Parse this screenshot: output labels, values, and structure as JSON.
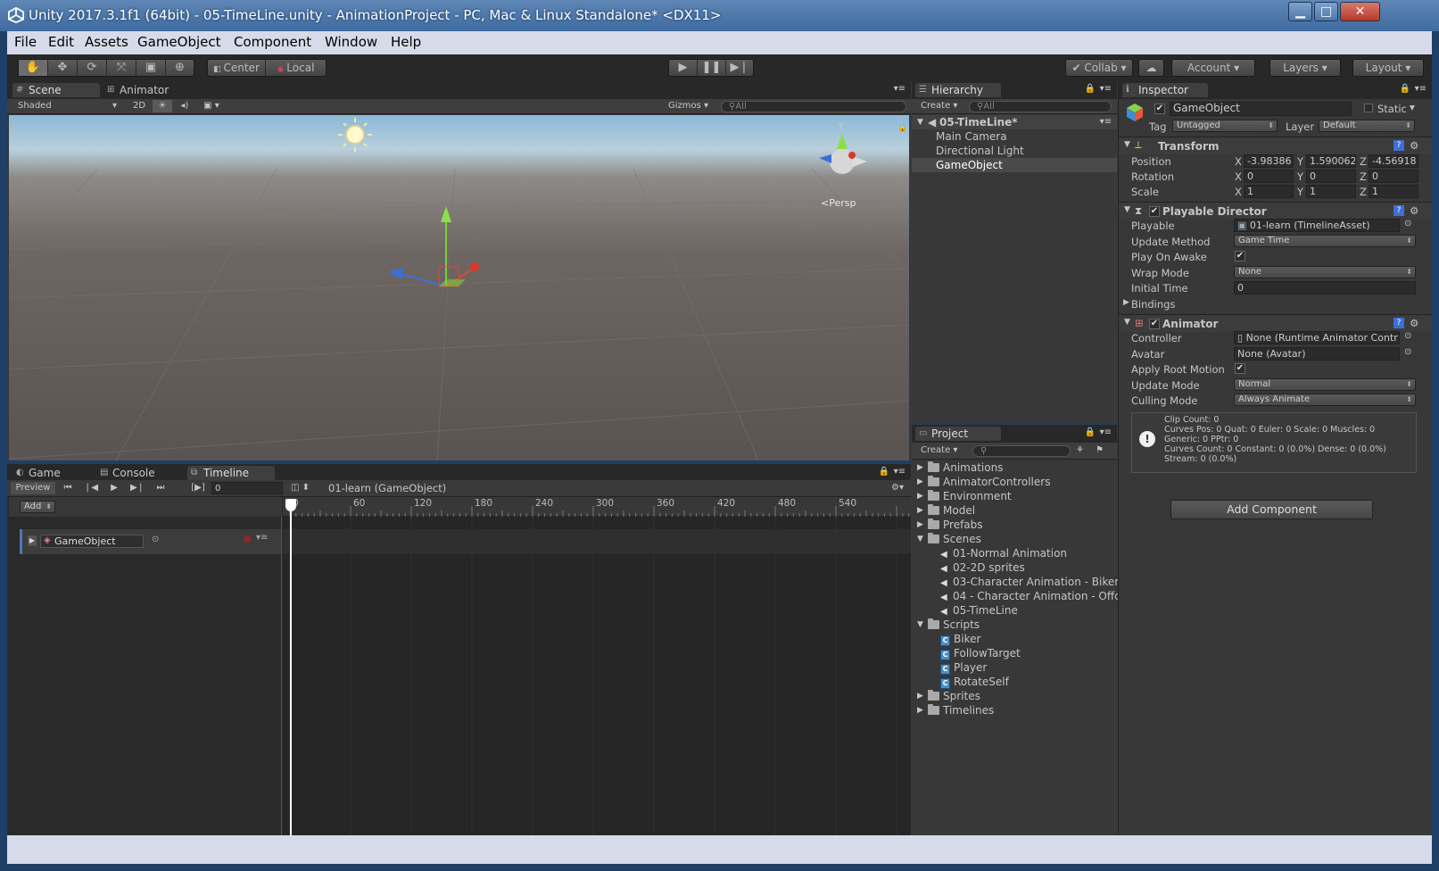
{
  "window": {
    "title": "Unity 2017.3.1f1 (64bit) - 05-TimeLine.unity - AnimationProject - PC, Mac & Linux Standalone* <DX11>",
    "minimize": "▁",
    "maximize": "□",
    "close": "✕"
  },
  "menu": [
    "File",
    "Edit",
    "Assets",
    "GameObject",
    "Component",
    "Window",
    "Help"
  ],
  "toolbar": {
    "pivot_center": "Center",
    "pivot_local": "Local",
    "collab": "Collab",
    "account": "Account",
    "layers": "Layers",
    "layout": "Layout"
  },
  "scene": {
    "tabs": [
      "Scene",
      "Animator"
    ],
    "shading": "Shaded",
    "mode_2d": "2D",
    "gizmos": "Gizmos",
    "search_placeholder": "All",
    "persp_label": "Persp",
    "gizmo_y": "y"
  },
  "bottom": {
    "tabs": [
      "Game",
      "Console",
      "Timeline"
    ],
    "preview": "Preview",
    "frame": "0",
    "asset": "01-learn (GameObject)",
    "add": "Add",
    "ruler": [
      "0",
      "60",
      "120",
      "180",
      "240",
      "300",
      "360",
      "420",
      "480",
      "540"
    ],
    "track_name": "GameObject"
  },
  "hierarchy": {
    "tab": "Hierarchy",
    "create": "Create",
    "search_placeholder": "All",
    "scene": "05-TimeLine*",
    "items": [
      "Main Camera",
      "Directional Light",
      "GameObject"
    ]
  },
  "project": {
    "tab": "Project",
    "create": "Create",
    "folders": [
      "Animations",
      "AnimatorControllers",
      "Environment",
      "Model",
      "Prefabs",
      "Scenes"
    ],
    "scenes": [
      "01-Normal Animation",
      "02-2D sprites",
      "03-Character Animation - Biker",
      "04 - Character Animation - Offc",
      "05-TimeLine"
    ],
    "scripts_folder": "Scripts",
    "scripts": [
      "Biker",
      "FollowTarget",
      "Player",
      "RotateSelf"
    ],
    "folders_after": [
      "Sprites",
      "Timelines"
    ]
  },
  "inspector": {
    "tab": "Inspector",
    "object_name": "GameObject",
    "static_label": "Static",
    "tag_label": "Tag",
    "tag_value": "Untagged",
    "layer_label": "Layer",
    "layer_value": "Default",
    "transform": {
      "title": "Transform",
      "position": {
        "label": "Position",
        "x": "-3.98386",
        "y": "1.590062",
        "z": "-4.56918"
      },
      "rotation": {
        "label": "Rotation",
        "x": "0",
        "y": "0",
        "z": "0"
      },
      "scale": {
        "label": "Scale",
        "x": "1",
        "y": "1",
        "z": "1"
      }
    },
    "axis": {
      "x": "X",
      "y": "Y",
      "z": "Z"
    },
    "director": {
      "title": "Playable Director",
      "playable_label": "Playable",
      "playable_value": "01-learn (TimelineAsset)",
      "update_method_label": "Update Method",
      "update_method_value": "Game Time",
      "play_on_awake_label": "Play On Awake",
      "wrap_mode_label": "Wrap Mode",
      "wrap_mode_value": "None",
      "initial_time_label": "Initial Time",
      "initial_time_value": "0",
      "bindings_label": "Bindings"
    },
    "animator": {
      "title": "Animator",
      "controller_label": "Controller",
      "controller_value": "None (Runtime Animator Contr",
      "avatar_label": "Avatar",
      "avatar_value": "None (Avatar)",
      "apply_root_label": "Apply Root Motion",
      "update_mode_label": "Update Mode",
      "update_mode_value": "Normal",
      "culling_mode_label": "Culling Mode",
      "culling_mode_value": "Always Animate"
    },
    "info": [
      "Clip Count: 0",
      "Curves Pos: 0 Quat: 0 Euler: 0 Scale: 0 Muscles: 0",
      "Generic: 0 PPtr: 0",
      "Curves Count: 0 Constant: 0 (0.0%) Dense: 0 (0.0%)",
      "Stream: 0 (0.0%)"
    ],
    "add_component": "Add Component"
  },
  "colors": {
    "accent_selected": "#3e5f96",
    "title_blue": "#3f6b9f",
    "panel": "#383838"
  }
}
